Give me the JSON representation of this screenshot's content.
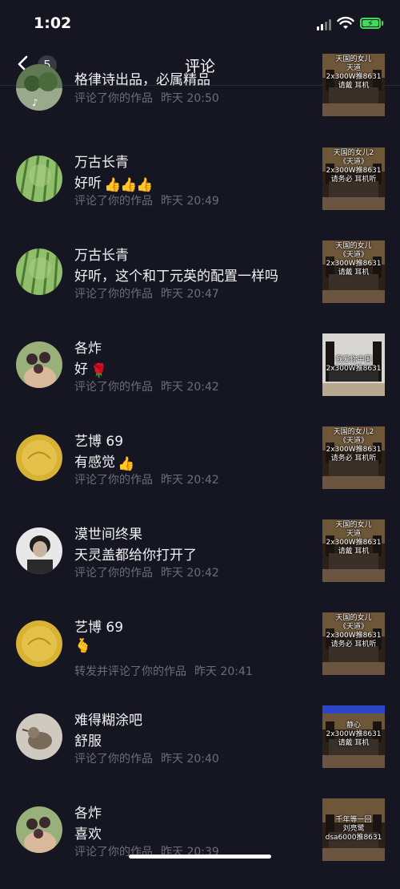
{
  "status_bar": {
    "time": "1:02"
  },
  "nav": {
    "badge": "5",
    "title": "评论"
  },
  "comments": [
    {
      "name": "",
      "text": "格律诗出品，必属精品",
      "action": "评论了你的作品",
      "time": "昨天 20:50",
      "thumb": [
        "天国的女儿",
        "天道",
        "2x300W推8631",
        "请戴    耳机"
      ]
    },
    {
      "name": "万古长青",
      "text": "好听",
      "action": "评论了你的作品",
      "time": "昨天 20:49",
      "thumb": [
        "天国的女儿2",
        "《天道》",
        "2x300W推8631",
        "请务必    耳机听"
      ]
    },
    {
      "name": "万古长青",
      "text": "好听，这个和丁元英的配置一样吗",
      "action": "评论了你的作品",
      "time": "昨天 20:47",
      "thumb": [
        "天国的女儿",
        "《天道》",
        "2x300W推8631",
        "请戴    耳机"
      ]
    },
    {
      "name": "各炸",
      "text": "好",
      "action": "评论了你的作品",
      "time": "昨天 20:42",
      "thumb": [
        "我爱你中国",
        "2x300W推8631"
      ]
    },
    {
      "name": "艺博 69",
      "text": "有感觉",
      "action": "评论了你的作品",
      "time": "昨天 20:42",
      "thumb": [
        "天国的女儿2",
        "《天道》",
        "2x300W推8631",
        "请务必    耳机听"
      ]
    },
    {
      "name": "漠世间终果",
      "text": "天灵盖都给你打开了",
      "action": "评论了你的作品",
      "time": "昨天 20:42",
      "thumb": [
        "天国的女儿",
        "天道",
        "2x300W推8631",
        "请戴    耳机"
      ]
    },
    {
      "name": "艺博 69",
      "text": "",
      "action": "转发并评论了你的作品",
      "time": "昨天 20:41",
      "thumb": [
        "天国的女儿",
        "《天道》",
        "2x300W推8631",
        "请务必    耳机听"
      ]
    },
    {
      "name": "难得糊涂吧",
      "text": "舒服",
      "action": "评论了你的作品",
      "time": "昨天 20:40",
      "thumb": [
        "静心",
        "2x300W推8631",
        "请戴    耳机"
      ]
    },
    {
      "name": "各炸",
      "text": "喜欢",
      "action": "评论了你的作品",
      "time": "昨天 20:39",
      "thumb": [
        "千年等一回",
        "刘亮鹭",
        "dsa6000推8631"
      ]
    }
  ]
}
